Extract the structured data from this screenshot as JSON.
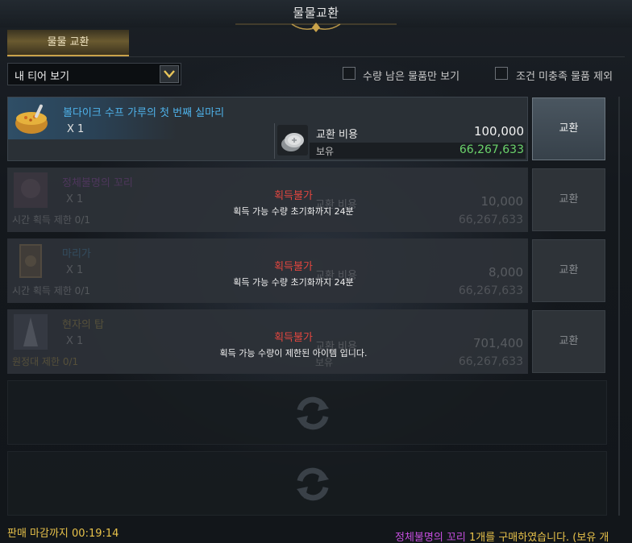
{
  "window": {
    "title": "물물교환"
  },
  "tabs": [
    {
      "label": "물물 교환"
    }
  ],
  "filter": {
    "tier_dropdown": "내 티어 보기",
    "checkbox_remaining": "수량 남은 물품만 보기",
    "checkbox_unmet": "조건 미충족 물품 제외"
  },
  "rows": [
    {
      "name": "볼다이크 수프 가루의 첫 번째 실마리",
      "qty": "X 1",
      "cost_label": "교환 비용",
      "cost": "100,000",
      "owned_label": "보유",
      "owned": "66,267,633",
      "button": "교환"
    },
    {
      "name": "정체불명의 꼬리",
      "qty": "X 1",
      "limit": "시간 획득 제한 0/1",
      "cost_label": "교환 비용",
      "cost": "10,000",
      "owned": "66,267,633",
      "status": "획득불가",
      "reason": "획득 가능 수량 초기화까지 24분",
      "button": "교환"
    },
    {
      "name": "마리가",
      "qty": "X 1",
      "limit": "시간 획득 제한 0/1",
      "cost_label": "교환 비용",
      "cost": "8,000",
      "owned": "66,267,633",
      "status": "획득불가",
      "reason": "획득 가능 수량 초기화까지 24분",
      "button": "교환"
    },
    {
      "name": "현자의 탑",
      "qty": "X 1",
      "limit": "원정대 제한 0/1",
      "cost_label": "교환 비용",
      "cost": "701,400",
      "owned_label": "보유",
      "owned": "66,267,633",
      "status": "획득불가",
      "reason": "획득 가능 수량이 제한된 아이템 입니다.",
      "button": "교환"
    }
  ],
  "footer": {
    "deadline": "판매 마감까지 00:19:14",
    "notice_item": "정체불명의 꼬리",
    "notice_count": "1개",
    "notice_rest": "를 구매하였습니다. (보유 개"
  },
  "colors": {
    "item_name": "#4fb2ea",
    "owned_value": "#6bd36b",
    "unavailable": "#e2463f",
    "gold": "#e8c24a",
    "purple": "#c64fe0"
  },
  "icons": [
    "dropdown-chevron-icon",
    "soup-bowl-icon",
    "silver-coin-icon",
    "swap-arrows-icon"
  ]
}
